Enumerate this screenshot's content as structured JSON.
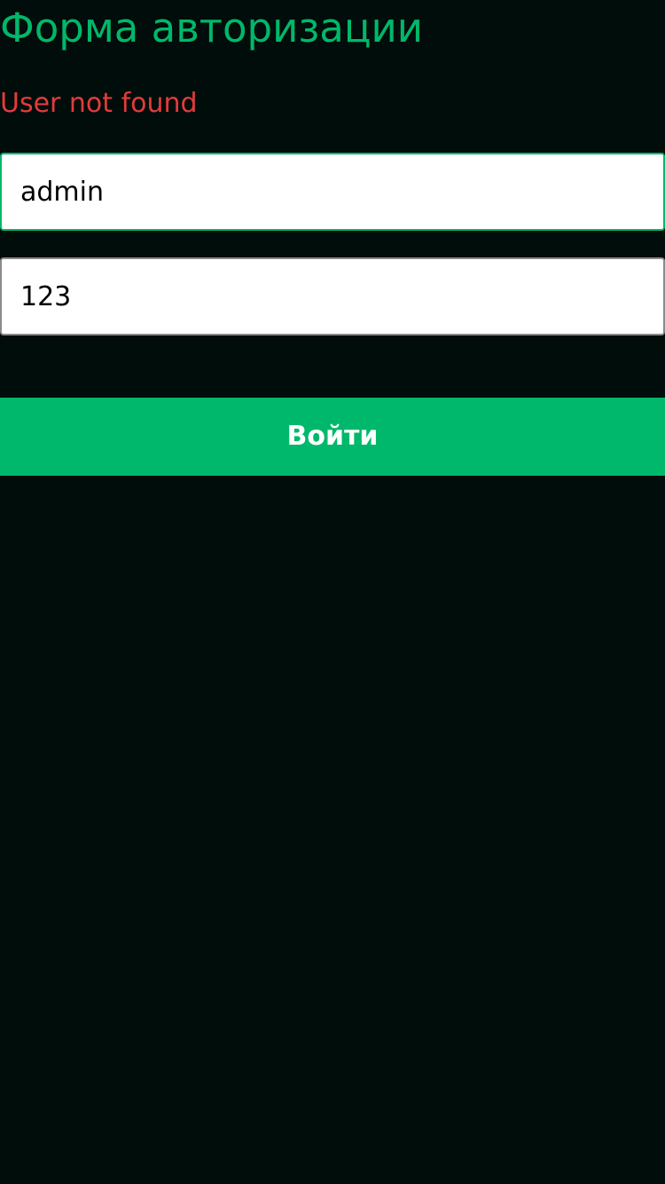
{
  "form": {
    "title": "Форма авторизации",
    "error_message": "User not found",
    "login_value": "admin",
    "password_value": "123",
    "submit_label": "Войти"
  },
  "colors": {
    "background": "#000d0a",
    "accent": "#00b86b",
    "error": "#e23b3b",
    "field_background": "#ffffff"
  }
}
